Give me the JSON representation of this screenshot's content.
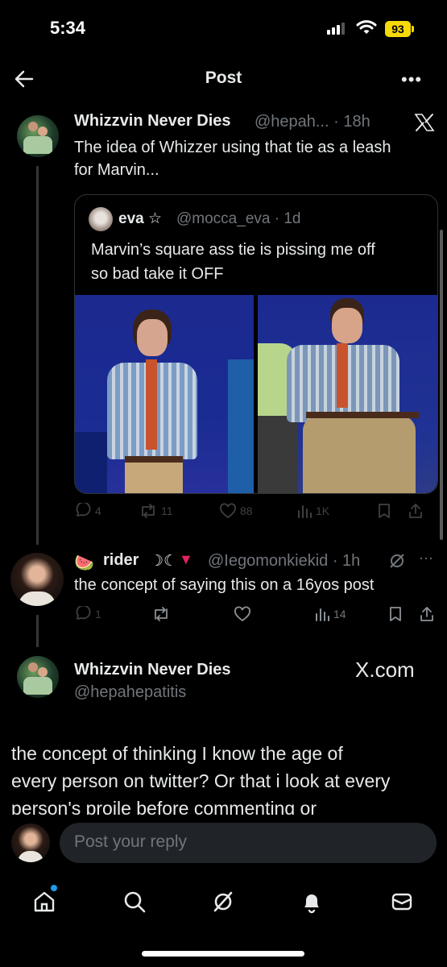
{
  "status": {
    "time": "5:34",
    "battery": "93"
  },
  "header": {
    "title": "Post",
    "more": "•••"
  },
  "post": {
    "author": "Whizzvin Never Dies",
    "handle_time": "@hepah... · 18h",
    "text_line1": "The idea of Whizzer using that tie as a leash",
    "text_line2": "for Marvin...",
    "quote": {
      "author": "eva ☆",
      "handle_time": "@mocca_eva · 1d",
      "text_line1": "Marvin’s square ass tie is pissing me off",
      "text_line2": "so bad take it OFF"
    },
    "actions": {
      "replies": "4",
      "reposts": "11",
      "likes": "88",
      "views": "1K"
    }
  },
  "reply": {
    "author": "rider",
    "handle_time": "@Iegomonkiekid · 1h",
    "text": "the concept of saying this on a 16yos post",
    "actions": {
      "replies": "1",
      "views": "14"
    }
  },
  "main_reply": {
    "author": "Whizzvin Never Dies",
    "handle": "@hepahepatitis",
    "brand": "X.com",
    "text_line1": "the concept of thinking I know the age of",
    "text_line2": "every person on twitter? Or that i look at every",
    "text_line3": "person's proile before commenting or"
  },
  "composer": {
    "placeholder": "Post your reply"
  },
  "nav": [
    "home-icon",
    "search-icon",
    "grok-icon",
    "notifications-icon",
    "messages-icon"
  ]
}
